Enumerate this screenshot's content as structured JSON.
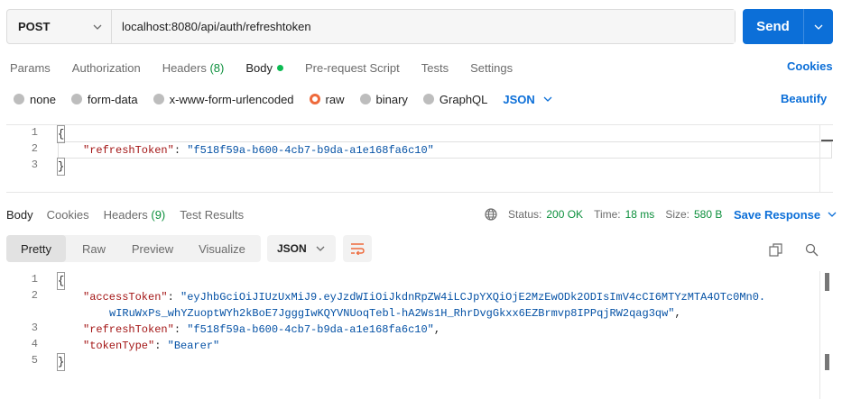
{
  "request": {
    "method": "POST",
    "url": "localhost:8080/api/auth/refreshtoken",
    "send_label": "Send"
  },
  "request_tabs": {
    "params": "Params",
    "authorization": "Authorization",
    "headers": "Headers",
    "headers_count": "(8)",
    "body": "Body",
    "prerequest": "Pre-request Script",
    "tests": "Tests",
    "settings": "Settings",
    "cookies": "Cookies"
  },
  "body_types": {
    "none": "none",
    "form_data": "form-data",
    "urlencoded": "x-www-form-urlencoded",
    "raw": "raw",
    "binary": "binary",
    "graphql": "GraphQL",
    "format": "JSON",
    "beautify": "Beautify",
    "selected": "raw"
  },
  "request_body": {
    "line_numbers": [
      "1",
      "2",
      "3"
    ],
    "open_brace": "{",
    "close_brace": "}",
    "key": "\"refreshToken\"",
    "value": "\"f518f59a-b600-4cb7-b9da-a1e168fa6c10\""
  },
  "response_tabs": {
    "body": "Body",
    "cookies": "Cookies",
    "headers": "Headers",
    "headers_count": "(9)",
    "test_results": "Test Results"
  },
  "response_status": {
    "status_label": "Status:",
    "status_value": "200 OK",
    "time_label": "Time:",
    "time_value": "18 ms",
    "size_label": "Size:",
    "size_value": "580 B",
    "save_label": "Save Response"
  },
  "response_view": {
    "pretty": "Pretty",
    "raw": "Raw",
    "preview": "Preview",
    "visualize": "Visualize",
    "format": "JSON"
  },
  "response_body": {
    "line_numbers": [
      "1",
      "2",
      "3",
      "4",
      "5"
    ],
    "open_brace": "{",
    "close_brace": "}",
    "access_key": "\"accessToken\"",
    "access_value_1": "\"eyJhbGciOiJIUzUxMiJ9.eyJzdWIiOiJkdnRpZW4iLCJpYXQiOjE2MzEwODk2ODIsImV4cCI6MTYzMTA4OTc0Mn0.",
    "access_value_2": "wIRuWxPs_whYZuoptWYh2kBoE7JgggIwKQYVNUoqTebl-hA2Ws1H_RhrDvgGkxx6EZBrmvp8IPPqjRW2qag3qw\"",
    "refresh_key": "\"refreshToken\"",
    "refresh_value": "\"f518f59a-b600-4cb7-b9da-a1e168fa6c10\"",
    "type_key": "\"tokenType\"",
    "type_value": "\"Bearer\""
  },
  "colors": {
    "accent": "#0c6fd8",
    "success": "#0c8f3c",
    "radio_selected": "#ee6a3c",
    "json_key": "#a31515",
    "json_string": "#0451a5"
  },
  "icons": [
    "chevron-down-icon",
    "globe-icon",
    "wrap-lines-icon",
    "copy-icon",
    "search-icon"
  ]
}
